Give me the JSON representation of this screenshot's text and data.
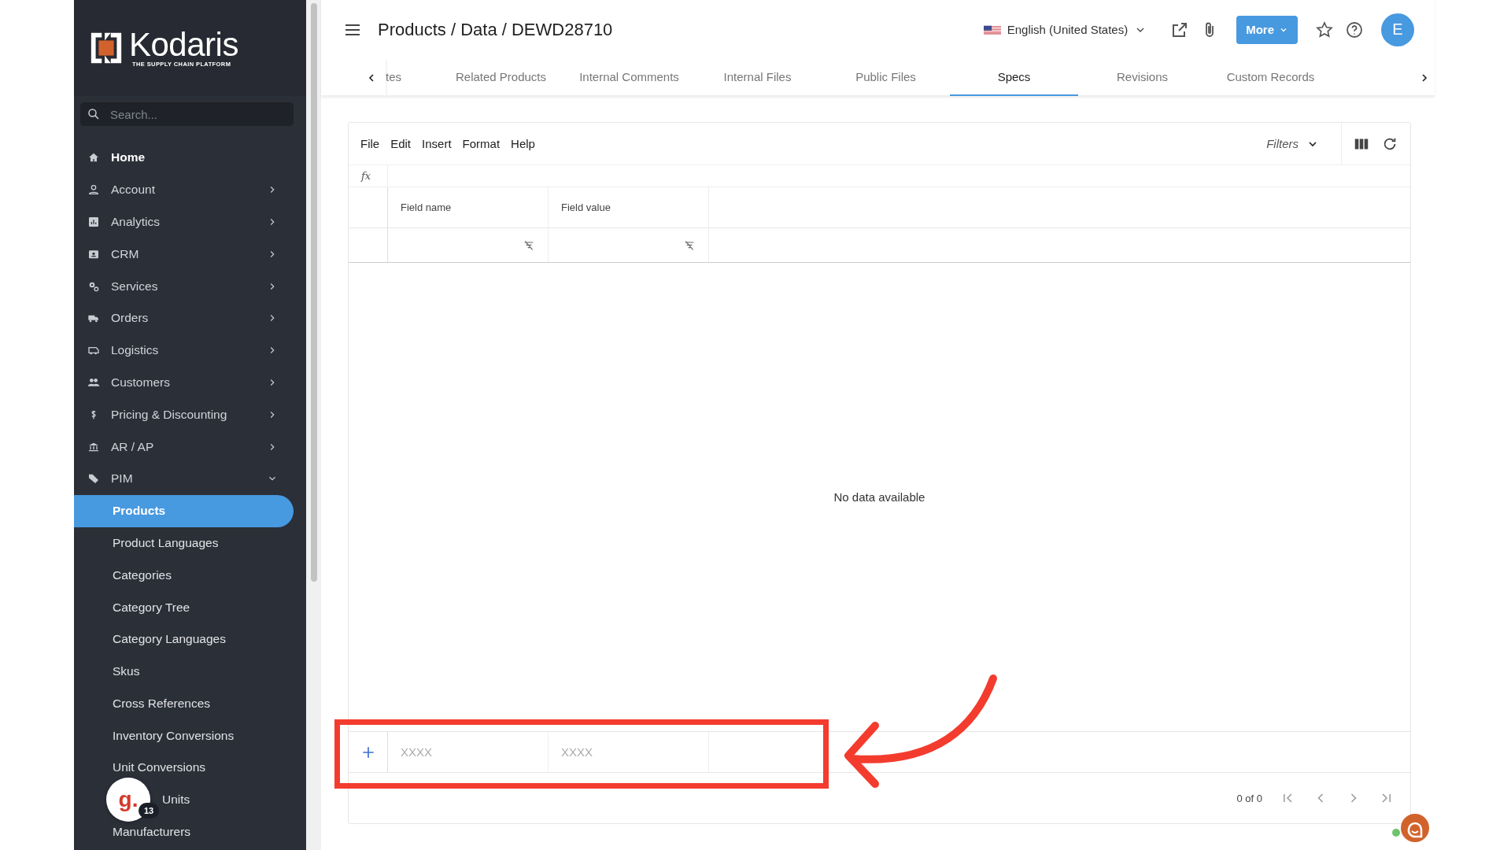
{
  "logo": {
    "name": "Kodaris",
    "tagline": "THE SUPPLY CHAIN PLATFORM"
  },
  "sidebar": {
    "search": {
      "placeholder": "Search..."
    },
    "items": [
      {
        "label": "Home"
      },
      {
        "label": "Account",
        "expanded": false
      },
      {
        "label": "Analytics",
        "expanded": false
      },
      {
        "label": "CRM",
        "expanded": false
      },
      {
        "label": "Services",
        "expanded": false
      },
      {
        "label": "Orders",
        "expanded": false
      },
      {
        "label": "Logistics",
        "expanded": false
      },
      {
        "label": "Customers",
        "expanded": false
      },
      {
        "label": "Pricing & Discounting",
        "expanded": false
      },
      {
        "label": "AR / AP",
        "expanded": false
      },
      {
        "label": "PIM",
        "expanded": true,
        "children": [
          {
            "label": "Products",
            "selected": true
          },
          {
            "label": "Product Languages",
            "selected": false
          },
          {
            "label": "Categories",
            "selected": false
          },
          {
            "label": "Category Tree",
            "selected": false
          },
          {
            "label": "Category Languages",
            "selected": false
          },
          {
            "label": "Skus",
            "selected": false
          },
          {
            "label": "Cross References",
            "selected": false
          },
          {
            "label": "Inventory Conversions",
            "selected": false
          },
          {
            "label": "Unit Conversions",
            "selected": false
          },
          {
            "label": "Units",
            "selected": false,
            "badge": {
              "letter": "g.",
              "count": "13"
            }
          },
          {
            "label": "Manufacturers",
            "selected": false
          }
        ]
      }
    ]
  },
  "header": {
    "breadcrumb": "Products / Data / DEWD28710",
    "language": "English (United States)",
    "more_button": "More",
    "avatar": "E"
  },
  "tabs": [
    {
      "label": "tes",
      "selected": false
    },
    {
      "label": "Related Products",
      "selected": false
    },
    {
      "label": "Internal Comments",
      "selected": false
    },
    {
      "label": "Internal Files",
      "selected": false
    },
    {
      "label": "Public Files",
      "selected": false
    },
    {
      "label": "Specs",
      "selected": true
    },
    {
      "label": "Revisions",
      "selected": false
    },
    {
      "label": "Custom Records",
      "selected": false
    }
  ],
  "grid": {
    "menu": [
      "File",
      "Edit",
      "Insert",
      "Format",
      "Help"
    ],
    "filters": "Filters",
    "formula_label": "fx",
    "columns": [
      "Field name",
      "Field value"
    ],
    "empty_text": "No data available",
    "new_row": [
      {
        "placeholder": "XXXX"
      },
      {
        "placeholder": "XXXX"
      }
    ],
    "pagination": "0 of 0"
  }
}
